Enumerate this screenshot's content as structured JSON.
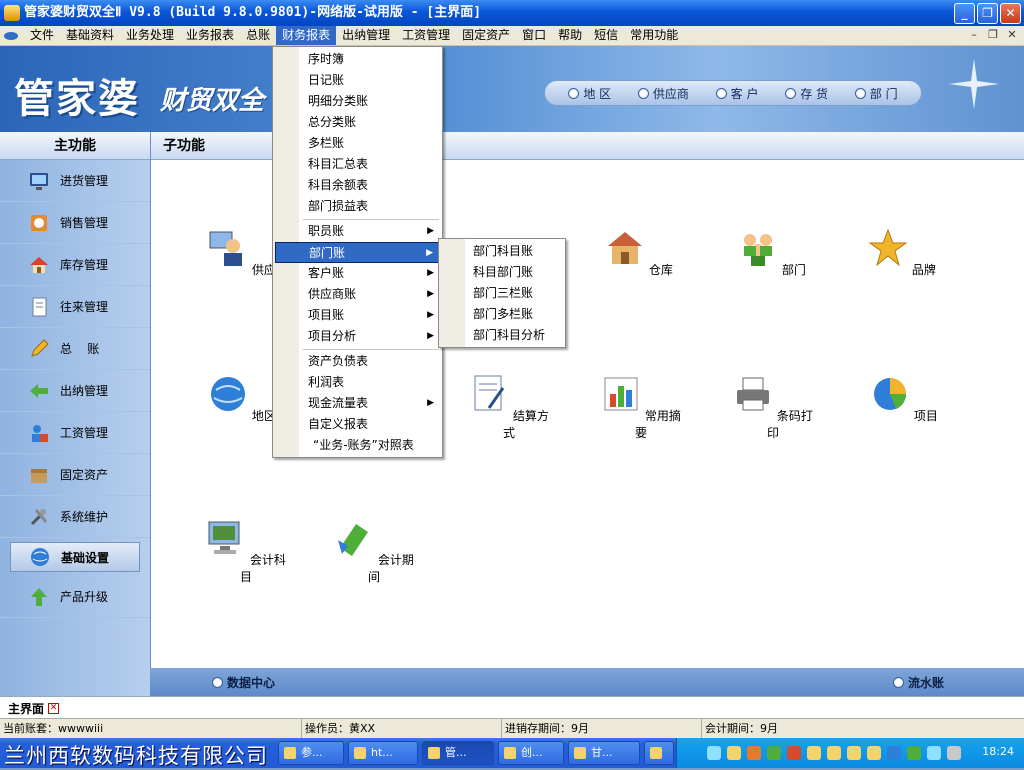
{
  "window": {
    "title": "管家婆财贸双全Ⅱ V9.8 (Build 9.8.0.9801)-网络版-试用版 - [主界面]"
  },
  "menubar": {
    "items": [
      "文件",
      "基础资料",
      "业务处理",
      "业务报表",
      "总账",
      "财务报表",
      "出纳管理",
      "工资管理",
      "固定资产",
      "窗口",
      "帮助",
      "短信",
      "常用功能"
    ],
    "active": "财务报表"
  },
  "banner": {
    "logo": "管家婆",
    "logo_sub": "财贸双全"
  },
  "quicknav": [
    "地 区",
    "供应商",
    "客 户",
    "存 货",
    "部 门"
  ],
  "sidebar": {
    "title": "主功能",
    "items": [
      {
        "label": "进货管理",
        "icon": "monitor-icon"
      },
      {
        "label": "销售管理",
        "icon": "sales-icon"
      },
      {
        "label": "库存管理",
        "icon": "house-icon"
      },
      {
        "label": "往来管理",
        "icon": "document-icon"
      },
      {
        "label": "总    账",
        "icon": "pencil-icon"
      },
      {
        "label": "出纳管理",
        "icon": "arrow-icon"
      },
      {
        "label": "工资管理",
        "icon": "salary-icon"
      },
      {
        "label": "固定资产",
        "icon": "box-icon"
      },
      {
        "label": "系统维护",
        "icon": "tools-icon"
      },
      {
        "label": "基础设置",
        "icon": "globe-icon",
        "selected": true
      },
      {
        "label": "产品升级",
        "icon": "up-arrow-icon"
      }
    ]
  },
  "main": {
    "title": "子功能",
    "icons": [
      {
        "label": "供应商",
        "icon": "supplier-icon"
      },
      {
        "label": "仓库",
        "icon": "warehouse-icon"
      },
      {
        "label": "部门",
        "icon": "department-icon"
      },
      {
        "label": "品牌",
        "icon": "star-icon"
      },
      {
        "label": "地区",
        "icon": "globe-icon"
      },
      {
        "label": "结算方式",
        "icon": "settlement-icon"
      },
      {
        "label": "常用摘要",
        "icon": "chart-icon"
      },
      {
        "label": "条码打印",
        "icon": "printer-icon"
      },
      {
        "label": "项目",
        "icon": "pie-icon"
      },
      {
        "label": "会计科目",
        "icon": "computer-icon"
      },
      {
        "label": "会计期间",
        "icon": "period-icon"
      }
    ]
  },
  "mainfoot": {
    "left": "数据中心",
    "right": "流水账"
  },
  "dropdown": {
    "items": [
      {
        "label": "序时簿"
      },
      {
        "label": "日记账"
      },
      {
        "label": "明细分类账"
      },
      {
        "label": "总分类账"
      },
      {
        "label": "多栏账"
      },
      {
        "label": "科目汇总表"
      },
      {
        "label": "科目余额表"
      },
      {
        "label": "部门损益表"
      },
      {
        "label": "职员账",
        "sub": true
      },
      {
        "label": "部门账",
        "sub": true,
        "hl": true
      },
      {
        "label": "客户账",
        "sub": true
      },
      {
        "label": "供应商账",
        "sub": true
      },
      {
        "label": "项目账",
        "sub": true
      },
      {
        "label": "项目分析",
        "sub": true
      },
      {
        "label": "资产负债表"
      },
      {
        "label": "利润表"
      },
      {
        "label": "现金流量表",
        "sub": true
      },
      {
        "label": "自定义报表"
      },
      {
        "label": "“业务-账务”对照表"
      }
    ]
  },
  "submenu": {
    "items": [
      "部门科目账",
      "科目部门账",
      "部门三栏账",
      "部门多栏账",
      "部门科目分析"
    ]
  },
  "tabstrip": {
    "tab": "主界面"
  },
  "statusbar": [
    "当前账套：wwwwiii",
    "操作员：黄XX",
    "进销存期间：9月",
    "会计期间：9月"
  ],
  "taskbar": {
    "company": "兰州西软数码科技有限公司",
    "tasks": [
      "参...",
      "ht...",
      "管...",
      "创...",
      "甘...",
      ""
    ],
    "clock": "18:24"
  }
}
